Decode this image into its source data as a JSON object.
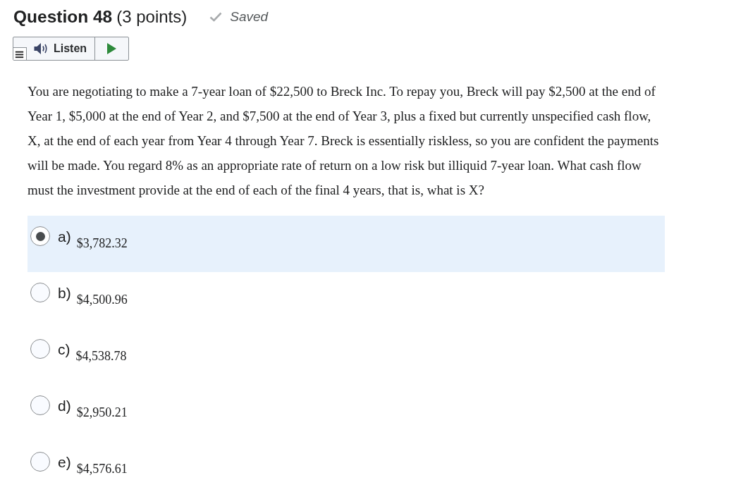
{
  "header": {
    "title": "Question 48",
    "points": "(3 points)",
    "status": "Saved"
  },
  "read_aloud": {
    "label": "Listen"
  },
  "question": "You are negotiating to make a 7-year loan of $22,500 to Breck Inc. To repay you, Breck will pay $2,500 at the end of Year 1, $5,000 at the end of Year 2, and $7,500 at the end of Year 3, plus a fixed but currently unspecified cash flow, X, at the end of each year from Year 4 through Year 7. Breck is essentially riskless, so you are confident the payments will be made. You regard 8% as an appropriate rate of return on a low risk but illiquid 7-year loan. What cash flow must the investment provide at the end of each of the final 4 years, that is, what is X?",
  "options": [
    {
      "letter": "a)",
      "value": "$3,782.32",
      "selected": true
    },
    {
      "letter": "b)",
      "value": "$4,500.96",
      "selected": false
    },
    {
      "letter": "c)",
      "value": "$4,538.78",
      "selected": false
    },
    {
      "letter": "d)",
      "value": "$2,950.21",
      "selected": false
    },
    {
      "letter": "e)",
      "value": "$4,576.61",
      "selected": false
    }
  ]
}
